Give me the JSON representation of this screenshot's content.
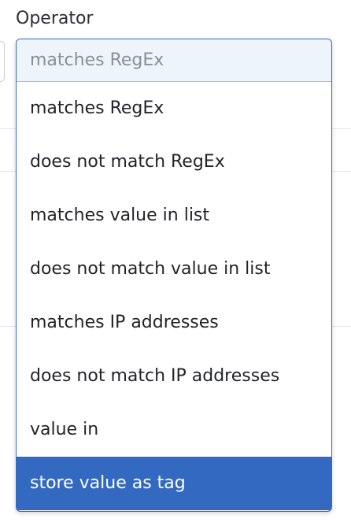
{
  "field": {
    "label": "Operator"
  },
  "select": {
    "current_value": "matches RegEx"
  },
  "options": [
    {
      "label": "matches RegEx"
    },
    {
      "label": "does not match RegEx"
    },
    {
      "label": "matches value in list"
    },
    {
      "label": "does not match value in list"
    },
    {
      "label": "matches IP addresses"
    },
    {
      "label": "does not match IP addresses"
    },
    {
      "label": "value in"
    },
    {
      "label": "store value as tag",
      "highlighted": true
    }
  ],
  "colors": {
    "highlight": "#3369c0",
    "border": "#3569c0",
    "current_bg": "#eef4fb"
  }
}
